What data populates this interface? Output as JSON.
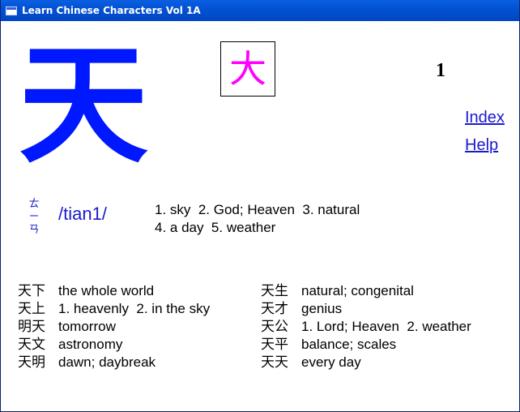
{
  "window": {
    "title": "Learn Chinese Characters Vol 1A"
  },
  "character": {
    "main": "天",
    "radical": "大",
    "lesson_number": "1",
    "zhuyin": [
      "ㄊ",
      "ㄧ",
      "ㄢ"
    ],
    "pinyin": "/tian1/",
    "meanings_line1": "1. sky  2. God; Heaven  3. natural",
    "meanings_line2": "4. a day  5. weather"
  },
  "nav": {
    "index_label": "Index",
    "help_label": "Help"
  },
  "words_left": [
    {
      "zh": "天下",
      "en": "the whole world"
    },
    {
      "zh": "天上",
      "en": "1. heavenly  2. in the sky"
    },
    {
      "zh": "明天",
      "en": "tomorrow"
    },
    {
      "zh": "天文",
      "en": "astronomy"
    },
    {
      "zh": "天明",
      "en": "dawn; daybreak"
    }
  ],
  "words_right": [
    {
      "zh": "天生",
      "en": "natural; congenital"
    },
    {
      "zh": "天才",
      "en": "genius"
    },
    {
      "zh": "天公",
      "en": "1. Lord; Heaven  2. weather"
    },
    {
      "zh": "天平",
      "en": "balance; scales"
    },
    {
      "zh": "天天",
      "en": "every day"
    }
  ],
  "colors": {
    "main_char": "#0018ff",
    "radical": "#ff00ff",
    "link": "#1a1acc",
    "titlebar": "#0252d4"
  }
}
